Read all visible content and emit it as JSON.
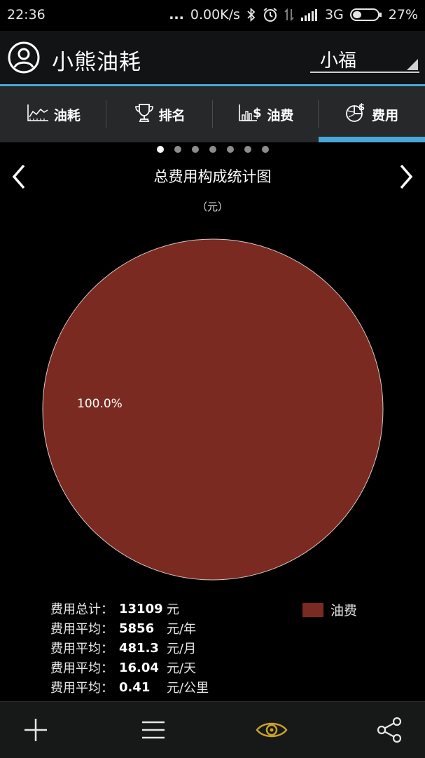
{
  "status_bar": {
    "time": "22:36",
    "dots": "...",
    "net_speed": "0.00K/s",
    "network": "3G",
    "battery": "27%"
  },
  "app_bar": {
    "title": "小熊油耗",
    "vehicle_selector": "小福"
  },
  "tabs": [
    {
      "label": "油耗",
      "icon": "line-chart-icon"
    },
    {
      "label": "排名",
      "icon": "trophy-icon"
    },
    {
      "label": "油费",
      "icon": "bar-dollar-icon"
    },
    {
      "label": "费用",
      "icon": "pie-dollar-icon",
      "active": true
    }
  ],
  "pager": {
    "count": 7,
    "active_index": 0
  },
  "chart_data": {
    "type": "pie",
    "title": "总费用构成统计图",
    "unit": "（元）",
    "slices": [
      {
        "name": "油费",
        "value": 100.0,
        "label": "100.0%",
        "color": "#7a2a20"
      }
    ],
    "legend_position": "right"
  },
  "stats": [
    {
      "key": "费用总计：",
      "value": "13109",
      "unit": "元"
    },
    {
      "key": "费用平均：",
      "value": "5856",
      "unit": "元/年"
    },
    {
      "key": "费用平均：",
      "value": "481.3",
      "unit": "元/月"
    },
    {
      "key": "费用平均：",
      "value": "16.04",
      "unit": "元/天"
    },
    {
      "key": "费用平均：",
      "value": "0.41",
      "unit": "元/公里"
    }
  ],
  "legend": {
    "label": "油费",
    "color": "#7a2a20"
  },
  "bottom_bar": [
    {
      "name": "add-button",
      "icon": "plus-icon"
    },
    {
      "name": "menu-button",
      "icon": "menu-icon"
    },
    {
      "name": "view-button",
      "icon": "eye-icon",
      "active_color": "#c9a227"
    },
    {
      "name": "share-button",
      "icon": "share-icon"
    }
  ]
}
